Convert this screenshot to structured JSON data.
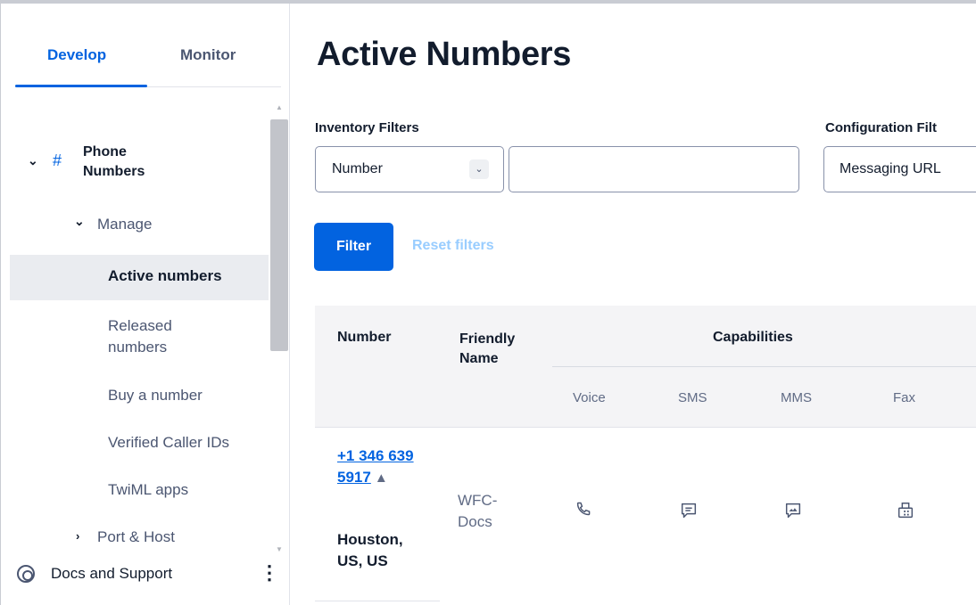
{
  "sidebar": {
    "tabs": [
      {
        "label": "Develop",
        "active": true
      },
      {
        "label": "Monitor",
        "active": false
      }
    ],
    "section": {
      "label": "Phone Numbers",
      "icon": "hash-icon"
    },
    "manage": {
      "label": "Manage"
    },
    "items": [
      {
        "label": "Active numbers",
        "active": true
      },
      {
        "label": "Released numbers"
      },
      {
        "label": "Buy a number"
      },
      {
        "label": "Verified Caller IDs"
      },
      {
        "label": "TwiML apps"
      }
    ],
    "port": {
      "label": "Port & Host"
    },
    "footer": {
      "label": "Docs and Support",
      "icon": "lifebuoy-icon",
      "menu_icon": "kebab-menu-icon"
    }
  },
  "main": {
    "title": "Active Numbers",
    "inventory_filters": {
      "label": "Inventory Filters",
      "selected": "Number",
      "input_value": ""
    },
    "configuration_filters": {
      "label": "Configuration Filt",
      "selected": "Messaging URL"
    },
    "filter_button": "Filter",
    "reset_button": "Reset filters",
    "table": {
      "headers": {
        "number": "Number",
        "friendly_name": "Friendly Name",
        "capabilities": "Capabilities",
        "sub": [
          "Voice",
          "SMS",
          "MMS",
          "Fax"
        ]
      },
      "rows": [
        {
          "number": "+1 346 639 5917",
          "location": "Houston, US, US",
          "friendly_name": "WFC-Docs",
          "capabilities": [
            "voice-icon",
            "sms-icon",
            "mms-icon",
            "fax-icon"
          ]
        }
      ]
    }
  },
  "colors": {
    "accent": "#0263e0",
    "reset_link": "#99cdff",
    "active_bg": "#eaecf0",
    "table_header_bg": "#f4f4f6"
  }
}
